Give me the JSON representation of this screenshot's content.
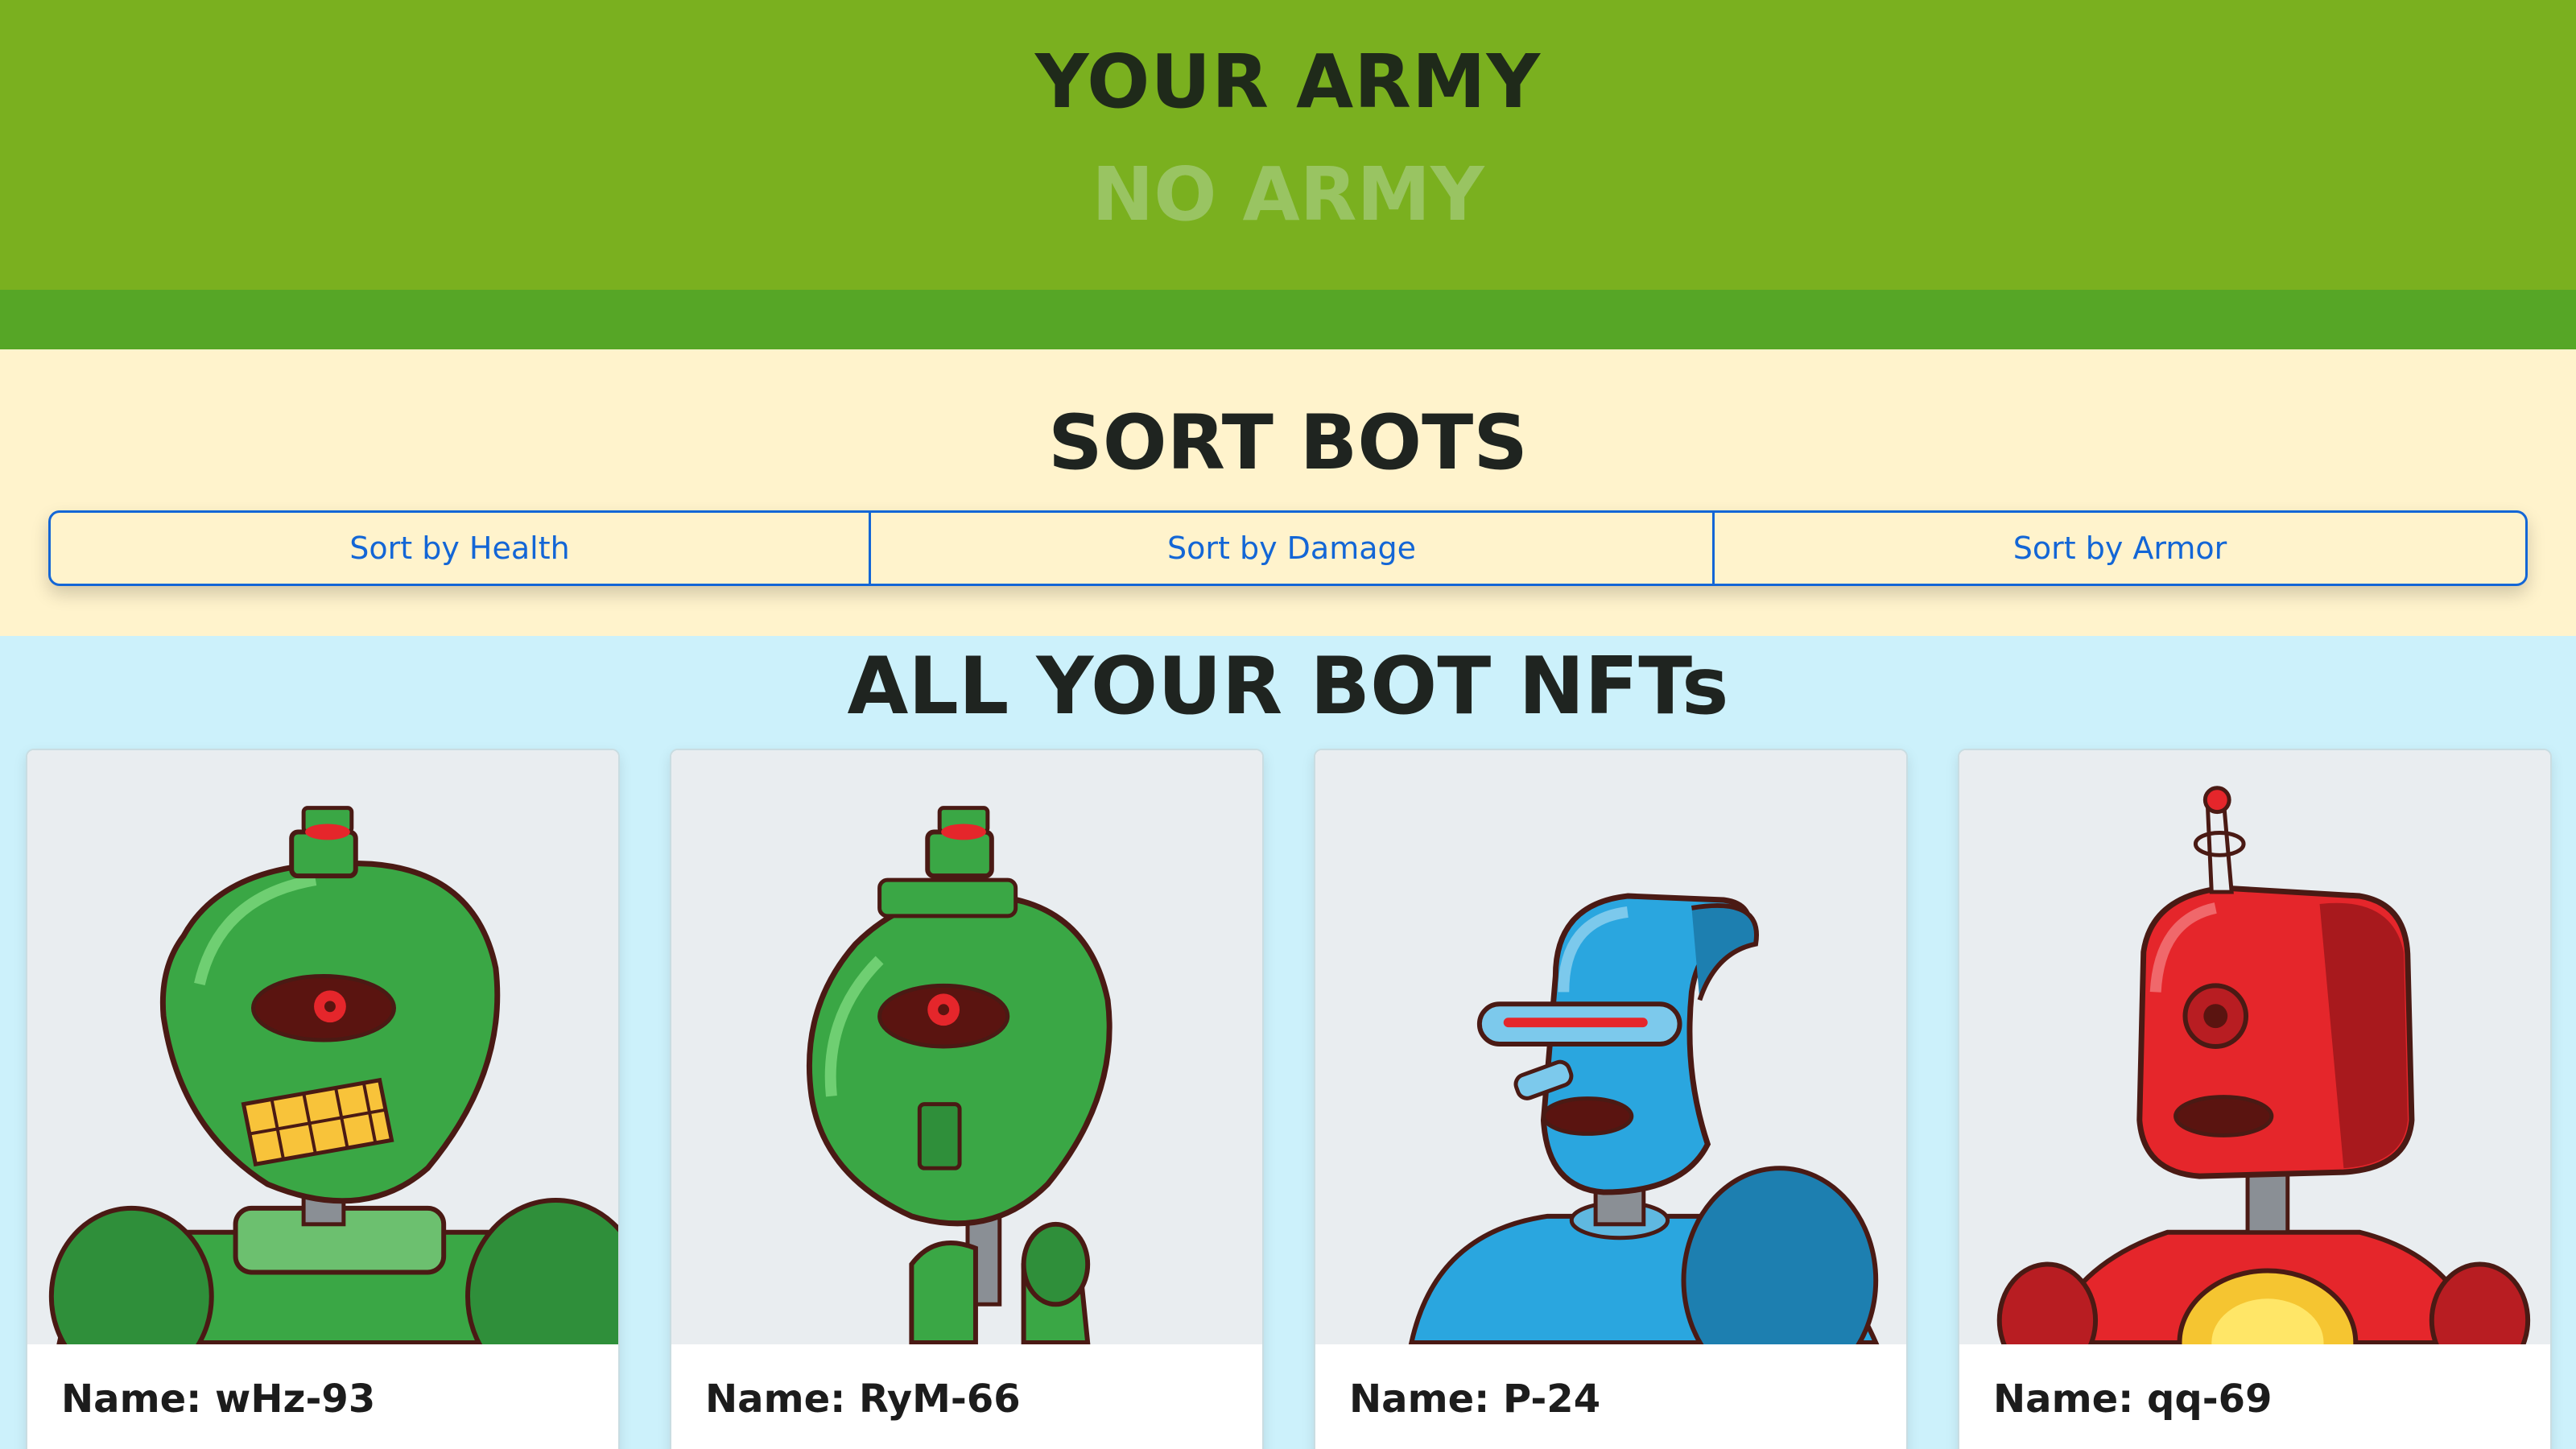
{
  "army": {
    "title": "YOUR ARMY",
    "empty_text": "NO ARMY"
  },
  "sort": {
    "title": "SORT BOTS",
    "buttons": [
      {
        "label": "Sort by Health"
      },
      {
        "label": "Sort by Damage"
      },
      {
        "label": "Sort by Armor"
      }
    ]
  },
  "collection": {
    "title": "ALL YOUR BOT NFTs",
    "bots": [
      {
        "name": "Name: wHz-93",
        "color": "#3aa745"
      },
      {
        "name": "Name: RyM-66",
        "color": "#3aa745"
      },
      {
        "name": "Name: P-24",
        "color": "#2aa6df"
      },
      {
        "name": "Name: qq-69",
        "color": "#e5262b"
      }
    ]
  },
  "colors": {
    "army_bg": "#7ab01f",
    "sort_bg": "#fff3cc",
    "collection_bg": "#ccf1fb",
    "accent": "#1366d6"
  }
}
